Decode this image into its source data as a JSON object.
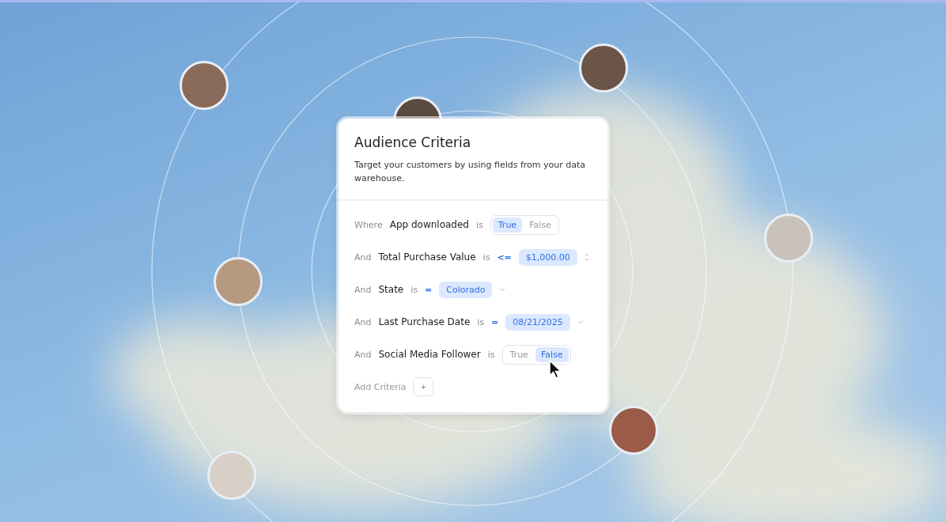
{
  "card": {
    "title": "Audience Criteria",
    "description": "Target your customers by using fields from your data warehouse."
  },
  "criteria": [
    {
      "kind": "toggle",
      "conjunction": "Where",
      "field": "App downloaded",
      "verb": "is",
      "options": [
        {
          "label": "True",
          "selected": true
        },
        {
          "label": "False",
          "selected": false
        }
      ]
    },
    {
      "kind": "number",
      "conjunction": "And",
      "field": "Total Purchase Value",
      "verb": "is",
      "operator": "<=",
      "value": "$1,000.00"
    },
    {
      "kind": "select",
      "conjunction": "And",
      "field": "State",
      "verb": "is",
      "operator": "=",
      "value": "Colorado"
    },
    {
      "kind": "select",
      "conjunction": "And",
      "field": "Last Purchase Date",
      "verb": "is",
      "operator": "=",
      "value": "08/21/2025"
    },
    {
      "kind": "toggle",
      "conjunction": "And",
      "field": "Social Media Follower",
      "verb": "is",
      "options": [
        {
          "label": "True",
          "selected": false
        },
        {
          "label": "False",
          "selected": true
        }
      ]
    }
  ],
  "add": {
    "label": "Add Criteria",
    "button": "+"
  }
}
